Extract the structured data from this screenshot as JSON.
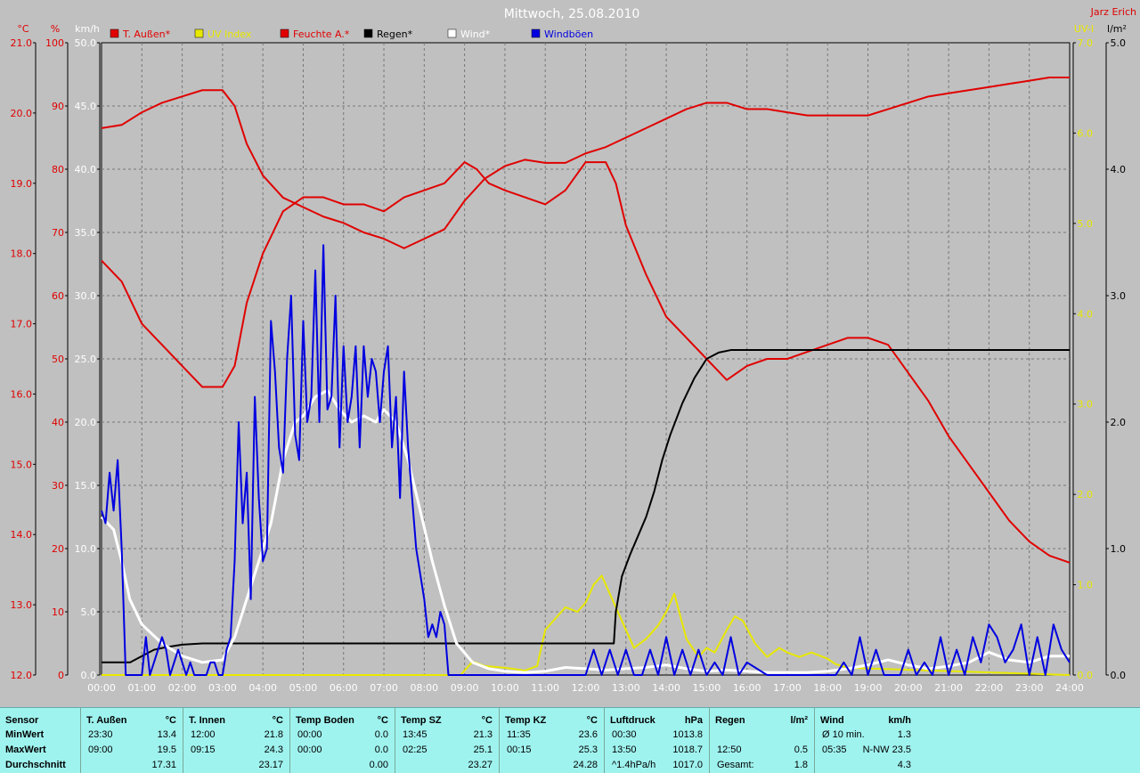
{
  "title": "Mittwoch, 25.08.2010",
  "author": "Jarz Erich",
  "colors": {
    "background": "#c0c0c0",
    "temp": "#e00000",
    "humidity": "#e00000",
    "uv": "#e8e800",
    "rain": "#000000",
    "wind": "#ffffff",
    "gust": "#0000e0",
    "table_bg": "#9ff3ef"
  },
  "chart_data": {
    "type": "line",
    "title": "Mittwoch, 25.08.2010",
    "legend": [
      "T. Außen*",
      "UV Index",
      "Feuchte A.*",
      "Regen*",
      "Wind*",
      "Windböen"
    ],
    "legend_placement": "top",
    "grid": true,
    "x_ticks": [
      "00:00",
      "01:00",
      "02:00",
      "03:00",
      "04:00",
      "05:00",
      "06:00",
      "07:00",
      "08:00",
      "09:00",
      "10:00",
      "11:00",
      "12:00",
      "13:00",
      "14:00",
      "15:00",
      "16:00",
      "17:00",
      "18:00",
      "19:00",
      "20:00",
      "21:00",
      "22:00",
      "23:00",
      "24:00"
    ],
    "x_range_hours": [
      0,
      24
    ],
    "axes": {
      "temp": {
        "unit": "°C",
        "range": [
          12.0,
          21.0
        ],
        "ticks": [
          "12.0",
          "13.0",
          "14.0",
          "15.0",
          "16.0",
          "17.0",
          "18.0",
          "19.0",
          "20.0",
          "21.0"
        ]
      },
      "humidity": {
        "unit": "%",
        "range": [
          0,
          100
        ],
        "ticks": [
          "0",
          "10",
          "20",
          "30",
          "40",
          "50",
          "60",
          "70",
          "80",
          "90",
          "100"
        ]
      },
      "wind": {
        "unit": "km/h",
        "range": [
          0,
          50
        ],
        "ticks": [
          "0.0",
          "5.0",
          "10.0",
          "15.0",
          "20.0",
          "25.0",
          "30.0",
          "35.0",
          "40.0",
          "45.0",
          "50.0"
        ]
      },
      "uv": {
        "unit": "UV-I",
        "range": [
          0,
          7
        ],
        "ticks": [
          "0.0",
          "1.0",
          "2.0",
          "3.0",
          "4.0",
          "5.0",
          "6.0",
          "7.0"
        ]
      },
      "rain": {
        "unit": "l/m²",
        "range": [
          0,
          5
        ],
        "ticks": [
          "0.0",
          "1.0",
          "2.0",
          "3.0",
          "4.0",
          "5.0"
        ]
      }
    },
    "series": [
      {
        "name": "T. Außen*",
        "axis": "temp",
        "color": "#e00000",
        "x": [
          0,
          0.5,
          1,
          1.5,
          2,
          2.5,
          3,
          3.3,
          3.6,
          4,
          4.5,
          4.75,
          5,
          5.5,
          6,
          6.5,
          7,
          7.5,
          8,
          8.5,
          9,
          9.3,
          9.6,
          10,
          10.5,
          11,
          11.5,
          12,
          12.5,
          12.75,
          13,
          13.5,
          14,
          14.5,
          15,
          15.5,
          16,
          16.5,
          17,
          17.5,
          18,
          18.5,
          19,
          19.5,
          20,
          20.5,
          21,
          21.5,
          22,
          22.5,
          23,
          23.5,
          24
        ],
        "y": [
          17.9,
          17.6,
          17.0,
          16.7,
          16.4,
          16.1,
          16.1,
          16.4,
          17.3,
          18.0,
          18.6,
          18.7,
          18.8,
          18.8,
          18.7,
          18.7,
          18.6,
          18.8,
          18.9,
          19.0,
          19.3,
          19.2,
          19.0,
          18.9,
          18.8,
          18.7,
          18.9,
          19.3,
          19.3,
          19.0,
          18.4,
          17.7,
          17.1,
          16.8,
          16.5,
          16.2,
          16.4,
          16.5,
          16.5,
          16.6,
          16.7,
          16.8,
          16.8,
          16.7,
          16.3,
          15.9,
          15.4,
          15.0,
          14.6,
          14.2,
          13.9,
          13.7,
          13.6
        ]
      },
      {
        "name": "Feuchte A.*",
        "axis": "humidity",
        "color": "#e00000",
        "x": [
          0,
          0.5,
          1,
          1.5,
          2,
          2.5,
          3,
          3.3,
          3.6,
          4,
          4.5,
          5,
          5.5,
          6,
          6.5,
          7,
          7.5,
          8,
          8.5,
          9,
          9.5,
          10,
          10.5,
          11,
          11.5,
          12,
          12.5,
          13,
          13.5,
          14,
          14.5,
          15,
          15.5,
          16,
          16.5,
          17,
          17.5,
          18,
          18.5,
          19,
          19.5,
          20,
          20.5,
          21,
          21.5,
          22,
          22.5,
          23,
          23.5,
          24
        ],
        "y": [
          86.5,
          87,
          89,
          90.5,
          91.5,
          92.5,
          92.5,
          90,
          84,
          79,
          75.5,
          74,
          72.5,
          71.5,
          70,
          69,
          67.5,
          69,
          70.5,
          75,
          78.5,
          80.5,
          81.5,
          81,
          81,
          82.5,
          83.5,
          85,
          86.5,
          88,
          89.5,
          90.5,
          90.5,
          89.5,
          89.5,
          89,
          88.5,
          88.5,
          88.5,
          88.5,
          89.5,
          90.5,
          91.5,
          92,
          92.5,
          93,
          93.5,
          94,
          94.5,
          94.5
        ]
      },
      {
        "name": "UV Index",
        "axis": "uv",
        "color": "#e8e800",
        "x": [
          0,
          8.9,
          9.0,
          9.2,
          9.5,
          10,
          10.5,
          10.8,
          11,
          11.2,
          11.5,
          11.8,
          12,
          12.2,
          12.4,
          12.6,
          12.8,
          13,
          13.2,
          13.5,
          13.8,
          14,
          14.2,
          14.5,
          14.8,
          15,
          15.2,
          15.5,
          15.7,
          15.9,
          16.2,
          16.5,
          16.8,
          17,
          17.3,
          17.6,
          18,
          18.2,
          18.5,
          24
        ],
        "y": [
          0,
          0,
          0.05,
          0.15,
          0.1,
          0.08,
          0.05,
          0.1,
          0.5,
          0.6,
          0.75,
          0.7,
          0.8,
          1.0,
          1.1,
          0.9,
          0.7,
          0.5,
          0.3,
          0.4,
          0.55,
          0.7,
          0.9,
          0.4,
          0.2,
          0.3,
          0.25,
          0.5,
          0.65,
          0.6,
          0.35,
          0.2,
          0.3,
          0.25,
          0.2,
          0.25,
          0.18,
          0.12,
          0.08,
          0
        ]
      },
      {
        "name": "Regen*",
        "axis": "rain",
        "color": "#000000",
        "x": [
          0,
          0.7,
          0.71,
          1.0,
          1.3,
          1.6,
          2,
          2.5,
          3,
          5,
          8,
          10,
          12,
          12.7,
          12.75,
          12.9,
          13.1,
          13.3,
          13.5,
          13.7,
          13.9,
          14.1,
          14.4,
          14.7,
          15,
          15.3,
          15.6,
          16,
          20,
          24
        ],
        "y": [
          0.1,
          0.1,
          0.1,
          0.15,
          0.2,
          0.22,
          0.24,
          0.25,
          0.25,
          0.25,
          0.25,
          0.25,
          0.25,
          0.25,
          0.5,
          0.78,
          0.95,
          1.1,
          1.25,
          1.45,
          1.7,
          1.9,
          2.15,
          2.35,
          2.5,
          2.55,
          2.57,
          2.57,
          2.57,
          2.57
        ]
      },
      {
        "name": "Wind*",
        "axis": "wind",
        "color": "#ffffff",
        "x": [
          0,
          0.3,
          0.5,
          0.7,
          1,
          1.5,
          2,
          2.5,
          3,
          3.3,
          3.6,
          3.9,
          4.2,
          4.5,
          4.8,
          5,
          5.3,
          5.6,
          5.9,
          6.2,
          6.5,
          6.8,
          7,
          7.3,
          7.6,
          7.9,
          8.2,
          8.5,
          8.8,
          9.2,
          9.6,
          10,
          10.5,
          11,
          11.5,
          12,
          12.5,
          13,
          13.5,
          14,
          14.5,
          15,
          15.5,
          16,
          16.5,
          17,
          17.5,
          18,
          18.5,
          19,
          19.5,
          20,
          20.5,
          21,
          21.5,
          22,
          22.5,
          23,
          23.5,
          24
        ],
        "y": [
          12.5,
          11.5,
          9,
          6,
          4,
          2.5,
          1.5,
          1,
          1.2,
          3,
          6,
          9,
          12,
          17,
          20,
          20.5,
          22,
          22.5,
          21,
          20,
          20.5,
          20,
          21,
          20,
          17,
          13,
          9,
          5.5,
          2.5,
          1,
          0.5,
          0.3,
          0.2,
          0.3,
          0.6,
          0.5,
          0.4,
          0.5,
          0.6,
          0.8,
          0.5,
          0.3,
          0.4,
          0.3,
          0.2,
          0.2,
          0.2,
          0.3,
          0.5,
          0.8,
          1.2,
          0.8,
          0.5,
          0.7,
          1.0,
          1.8,
          1.2,
          1.0,
          1.5,
          1.5
        ]
      },
      {
        "name": "Windböen",
        "axis": "wind",
        "color": "#0000e0",
        "x": [
          0,
          0.1,
          0.2,
          0.3,
          0.4,
          0.5,
          0.6,
          0.7,
          0.8,
          0.9,
          1.0,
          1.1,
          1.2,
          1.3,
          1.4,
          1.5,
          1.6,
          1.7,
          1.8,
          1.9,
          2.0,
          2.1,
          2.2,
          2.3,
          2.4,
          2.5,
          2.6,
          2.7,
          2.8,
          2.9,
          3.0,
          3.1,
          3.2,
          3.3,
          3.4,
          3.5,
          3.6,
          3.7,
          3.8,
          3.9,
          4.0,
          4.1,
          4.2,
          4.3,
          4.4,
          4.5,
          4.6,
          4.7,
          4.8,
          4.9,
          5.0,
          5.1,
          5.2,
          5.3,
          5.4,
          5.5,
          5.6,
          5.7,
          5.8,
          5.9,
          6.0,
          6.1,
          6.2,
          6.3,
          6.4,
          6.5,
          6.6,
          6.7,
          6.8,
          6.9,
          7.0,
          7.1,
          7.2,
          7.3,
          7.4,
          7.5,
          7.6,
          7.7,
          7.8,
          7.9,
          8.0,
          8.1,
          8.2,
          8.3,
          8.4,
          8.5,
          8.6,
          8.7,
          8.8,
          8.9,
          9.0,
          9.5,
          10,
          10.5,
          11,
          11.5,
          12,
          12.2,
          12.4,
          12.6,
          12.8,
          13,
          13.2,
          13.4,
          13.6,
          13.8,
          14,
          14.2,
          14.4,
          14.6,
          14.8,
          15,
          15.2,
          15.4,
          15.6,
          15.8,
          16,
          16.5,
          17,
          17.5,
          18,
          18.2,
          18.4,
          18.6,
          18.8,
          19,
          19.2,
          19.4,
          19.6,
          19.8,
          20,
          20.2,
          20.4,
          20.6,
          20.8,
          21,
          21.2,
          21.4,
          21.6,
          21.8,
          22,
          22.2,
          22.4,
          22.6,
          22.8,
          23,
          23.2,
          23.4,
          23.6,
          23.8,
          24
        ],
        "y": [
          13,
          12,
          16,
          13,
          17,
          10,
          0,
          0,
          0,
          0,
          0,
          3,
          0,
          1,
          2,
          3,
          2,
          0,
          1,
          2,
          1,
          0,
          1,
          0,
          0,
          0,
          0,
          1,
          1,
          0,
          0,
          2,
          3,
          9,
          20,
          12,
          16,
          6,
          22,
          14,
          9,
          10,
          28,
          24,
          18,
          16,
          25,
          30,
          19,
          17,
          28,
          20,
          22,
          32,
          20,
          34,
          21,
          22,
          30,
          18,
          26,
          20,
          22,
          26,
          18,
          26,
          22,
          25,
          24,
          20,
          24,
          26,
          18,
          22,
          14,
          24,
          18,
          14,
          10,
          8,
          6,
          3,
          4,
          3,
          5,
          4,
          0,
          0,
          0,
          0,
          0,
          0,
          0,
          0,
          0,
          0,
          0,
          2,
          0,
          2,
          0,
          2,
          0,
          0,
          2,
          0,
          3,
          0,
          2,
          0,
          2,
          0,
          1,
          0,
          3,
          0,
          1,
          0,
          0,
          0,
          0,
          0,
          1,
          0,
          3,
          0,
          2,
          0,
          0,
          0,
          2,
          0,
          1,
          0,
          3,
          0,
          2,
          0,
          3,
          1,
          4,
          3,
          1,
          2,
          4,
          0,
          3,
          0,
          4,
          2,
          1
        ]
      }
    ]
  },
  "table": {
    "columns": [
      {
        "name": "Sensor",
        "unit": "",
        "rows": [
          [
            "MinWert"
          ],
          [
            "MaxWert"
          ],
          [
            "Durchschnitt"
          ]
        ]
      },
      {
        "name": "T. Außen",
        "unit": "°C",
        "rows": [
          [
            "23:30",
            "13.4"
          ],
          [
            "09:00",
            "19.5"
          ],
          [
            "",
            "17.31"
          ]
        ]
      },
      {
        "name": "T. Innen",
        "unit": "°C",
        "rows": [
          [
            "12:00",
            "21.8"
          ],
          [
            "09:15",
            "24.3"
          ],
          [
            "",
            "23.17"
          ]
        ]
      },
      {
        "name": "Temp Boden",
        "unit": "°C",
        "rows": [
          [
            "00:00",
            "0.0"
          ],
          [
            "00:00",
            "0.0"
          ],
          [
            "",
            "0.00"
          ]
        ]
      },
      {
        "name": "Temp SZ",
        "unit": "°C",
        "rows": [
          [
            "13:45",
            "21.3"
          ],
          [
            "02:25",
            "25.1"
          ],
          [
            "",
            "23.27"
          ]
        ]
      },
      {
        "name": "Temp KZ",
        "unit": "°C",
        "rows": [
          [
            "11:35",
            "23.6"
          ],
          [
            "00:15",
            "25.3"
          ],
          [
            "",
            "24.28"
          ]
        ]
      },
      {
        "name": "Luftdruck",
        "unit": "hPa",
        "rows": [
          [
            "00:30",
            "1013.8"
          ],
          [
            "13:50",
            "1018.7"
          ],
          [
            "^1.4hPa/h",
            "1017.0"
          ]
        ]
      },
      {
        "name": "Regen",
        "unit": "l/m²",
        "rows": [
          [
            "",
            ""
          ],
          [
            "12:50",
            "0.5"
          ],
          [
            "Gesamt:",
            "1.8"
          ]
        ]
      },
      {
        "name": "Wind",
        "unit": "km/h",
        "rows": [
          [
            "Ø 10 min.",
            "1.3"
          ],
          [
            "05:35",
            "N-NW 23.5"
          ],
          [
            "",
            "4.3"
          ]
        ]
      }
    ]
  }
}
